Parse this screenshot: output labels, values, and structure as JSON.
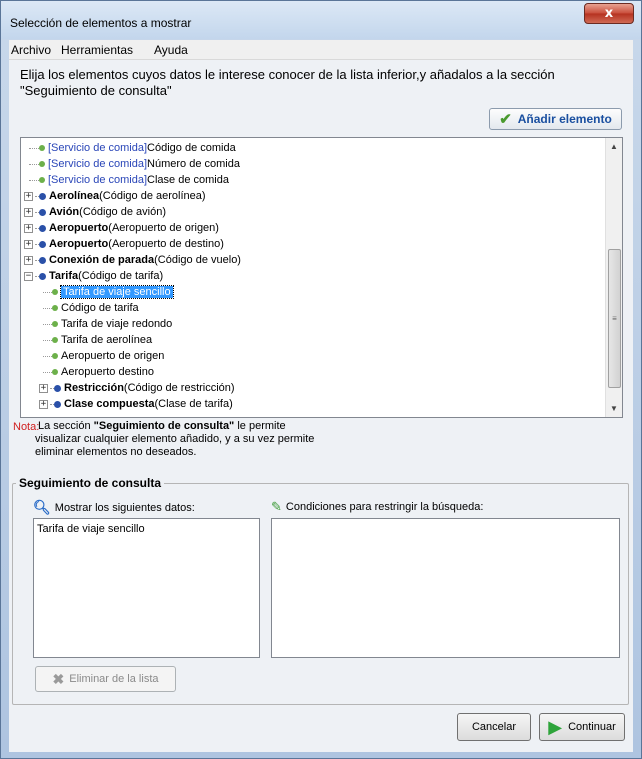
{
  "window": {
    "title": "Selección de elementos a mostrar",
    "close_label": "x"
  },
  "menu": [
    "Archivo",
    "Herramientas",
    "Ayuda"
  ],
  "intro_text": "Elija los elementos cuyos datos le interese conocer de la lista inferior,y añadalos a la sección \"Seguimiento de consulta\"",
  "add_button_label": "Añadir elemento",
  "tree": {
    "rows": [
      {
        "prefix": "[Servicio de comida]",
        "text": " Código de comida"
      },
      {
        "prefix": "[Servicio de comida]",
        "text": " Número de comida"
      },
      {
        "prefix": "[Servicio de comida]",
        "text": " Clase de comida"
      },
      {
        "bold": "Aerolínea",
        "text": " (Código de aerolínea)"
      },
      {
        "bold": "Avión",
        "text": " (Código de avión)"
      },
      {
        "bold": "Aeropuerto",
        "text": " (Aeropuerto de origen)"
      },
      {
        "bold": "Aeropuerto",
        "text": " (Aeropuerto de destino)"
      },
      {
        "bold": "Conexión de parada",
        "text": " (Código de vuelo)"
      },
      {
        "bold": "Tarifa",
        "text": " (Código de tarifa)"
      },
      {
        "text": "Tarifa de viaje sencillo"
      },
      {
        "text": "Código de tarifa"
      },
      {
        "text": "Tarifa de viaje redondo"
      },
      {
        "text": "Tarifa de aerolínea"
      },
      {
        "text": "Aeropuerto de origen"
      },
      {
        "text": "Aeropuerto destino"
      },
      {
        "bold": "Restricción",
        "text": " (Código de restricción)"
      },
      {
        "bold": "Clase compuesta",
        "text": " (Clase de tarifa)"
      }
    ]
  },
  "note": {
    "label": "Nota:",
    "line1_prefix": "La sección ",
    "line1_bold": "\"Seguimiento de consulta\"",
    "line1_suffix": " le permite",
    "line2": "visualizar cualquier elemento añadido, y a su vez permite",
    "line3": "eliminar elementos no deseados."
  },
  "tracking": {
    "title": "Seguimiento de consulta",
    "show_label": "Mostrar los siguientes datos:",
    "conditions_label": "Condiciones para restringir la búsqueda:",
    "shown_items": [
      "Tarifa de viaje sencillo"
    ],
    "remove_button_label": "Eliminar de la lista"
  },
  "buttons": {
    "cancel": "Cancelar",
    "continue": "Continuar"
  }
}
